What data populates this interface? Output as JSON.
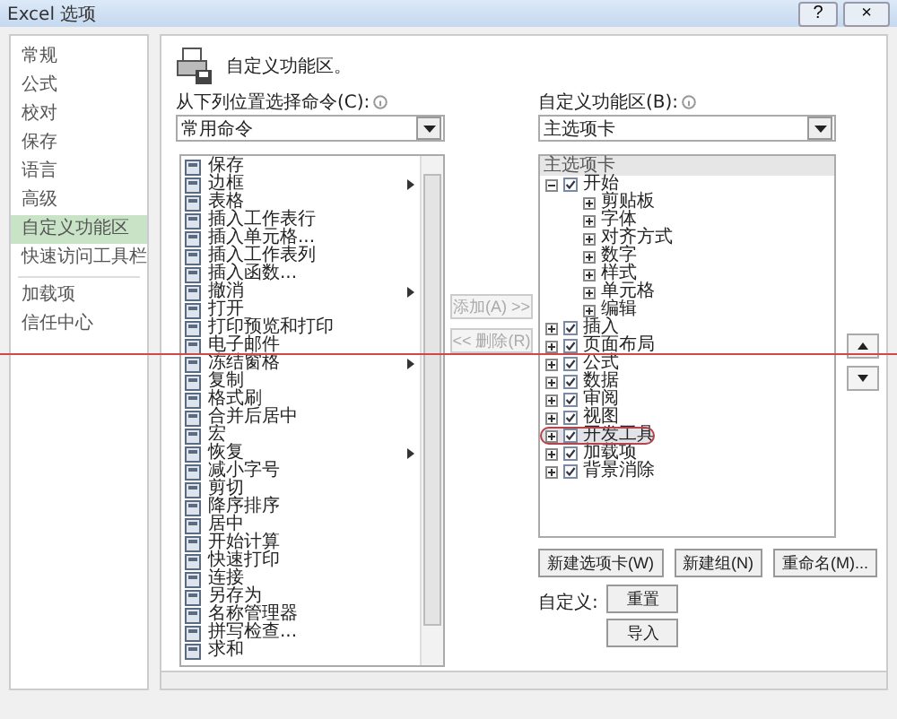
{
  "window": {
    "title": "Excel 选项",
    "help": "?",
    "close": "×"
  },
  "sidebar": {
    "groups": [
      [
        {
          "label": "常规",
          "selected": false
        },
        {
          "label": "公式",
          "selected": false
        },
        {
          "label": "校对",
          "selected": false
        },
        {
          "label": "保存",
          "selected": false
        },
        {
          "label": "语言",
          "selected": false
        },
        {
          "label": "高级",
          "selected": false
        },
        {
          "label": "自定义功能区",
          "selected": true
        },
        {
          "label": "快速访问工具栏",
          "selected": false
        }
      ],
      [
        {
          "label": "加载项",
          "selected": false
        },
        {
          "label": "信任中心",
          "selected": false
        }
      ]
    ]
  },
  "heading": "自定义功能区。",
  "commands": {
    "label": "从下列位置选择命令(C):",
    "dropdown": "常用命令",
    "items": [
      {
        "label": "保存",
        "submenu": false
      },
      {
        "label": "边框",
        "submenu": true
      },
      {
        "label": "表格",
        "submenu": false
      },
      {
        "label": "插入工作表行",
        "submenu": false
      },
      {
        "label": "插入单元格...",
        "submenu": false
      },
      {
        "label": "插入工作表列",
        "submenu": false
      },
      {
        "label": "插入函数...",
        "submenu": false
      },
      {
        "label": "撤消",
        "submenu": true
      },
      {
        "label": "打开",
        "submenu": false
      },
      {
        "label": "打印预览和打印",
        "submenu": false
      },
      {
        "label": "电子邮件",
        "submenu": false
      },
      {
        "label": "冻结窗格",
        "submenu": true
      },
      {
        "label": "复制",
        "submenu": false
      },
      {
        "label": "格式刷",
        "submenu": false
      },
      {
        "label": "合并后居中",
        "submenu": false
      },
      {
        "label": "宏",
        "submenu": false
      },
      {
        "label": "恢复",
        "submenu": true
      },
      {
        "label": "减小字号",
        "submenu": false
      },
      {
        "label": "剪切",
        "submenu": false
      },
      {
        "label": "降序排序",
        "submenu": false
      },
      {
        "label": "居中",
        "submenu": false
      },
      {
        "label": "开始计算",
        "submenu": false
      },
      {
        "label": "快速打印",
        "submenu": false
      },
      {
        "label": "连接",
        "submenu": false
      },
      {
        "label": "另存为",
        "submenu": false
      },
      {
        "label": "名称管理器",
        "submenu": false
      },
      {
        "label": "拼写检查...",
        "submenu": false
      },
      {
        "label": "求和",
        "submenu": false
      }
    ]
  },
  "middle_buttons": [
    {
      "label": "添加(A) >>",
      "disabled": true
    },
    {
      "label": "<< 删除(R)",
      "disabled": true
    }
  ],
  "ribbon": {
    "label": "自定义功能区(B):",
    "dropdown": "主选项卡",
    "tree_header": "主选项卡",
    "tabs": [
      {
        "label": "开始",
        "checked": true,
        "expanded": true,
        "selected": false,
        "children": [
          "剪贴板",
          "字体",
          "对齐方式",
          "数字",
          "样式",
          "单元格",
          "编辑"
        ]
      },
      {
        "label": "插入",
        "checked": true,
        "expanded": false,
        "selected": false
      },
      {
        "label": "页面布局",
        "checked": true,
        "expanded": false,
        "selected": false
      },
      {
        "label": "公式",
        "checked": true,
        "expanded": false,
        "selected": false
      },
      {
        "label": "数据",
        "checked": true,
        "expanded": false,
        "selected": false
      },
      {
        "label": "审阅",
        "checked": true,
        "expanded": false,
        "selected": false
      },
      {
        "label": "视图",
        "checked": true,
        "expanded": false,
        "selected": false
      },
      {
        "label": "开发工具",
        "checked": true,
        "expanded": false,
        "selected": true
      },
      {
        "label": "加载项",
        "checked": true,
        "expanded": false,
        "selected": false
      },
      {
        "label": "背景消除",
        "checked": true,
        "expanded": false,
        "selected": false
      }
    ],
    "buttons": [
      "新建选项卡(W)",
      "新建组(N)",
      "重命名(M)..."
    ]
  },
  "customize": {
    "label": "自定义:",
    "buttons": [
      "重置",
      "导入"
    ]
  }
}
